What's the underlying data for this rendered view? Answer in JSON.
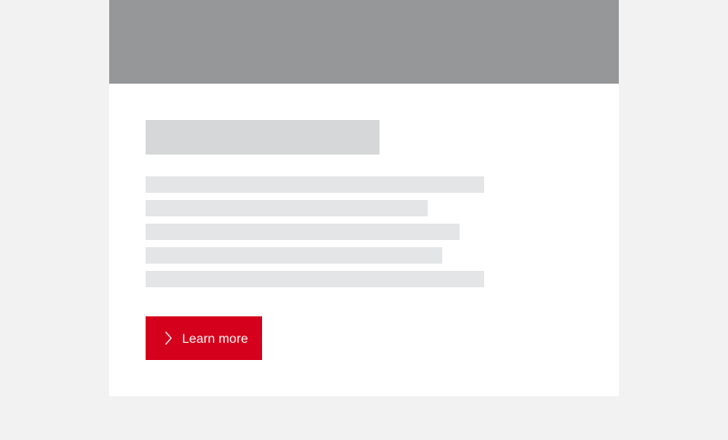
{
  "card": {
    "cta": {
      "label": "Learn more",
      "icon": "chevron-right-icon",
      "color": "#d5001c"
    }
  },
  "colors": {
    "background": "#f2f2f2",
    "card": "#ffffff",
    "hero_placeholder": "#969798",
    "title_placeholder": "#d6d7d8",
    "text_placeholder": "#e4e5e6"
  }
}
